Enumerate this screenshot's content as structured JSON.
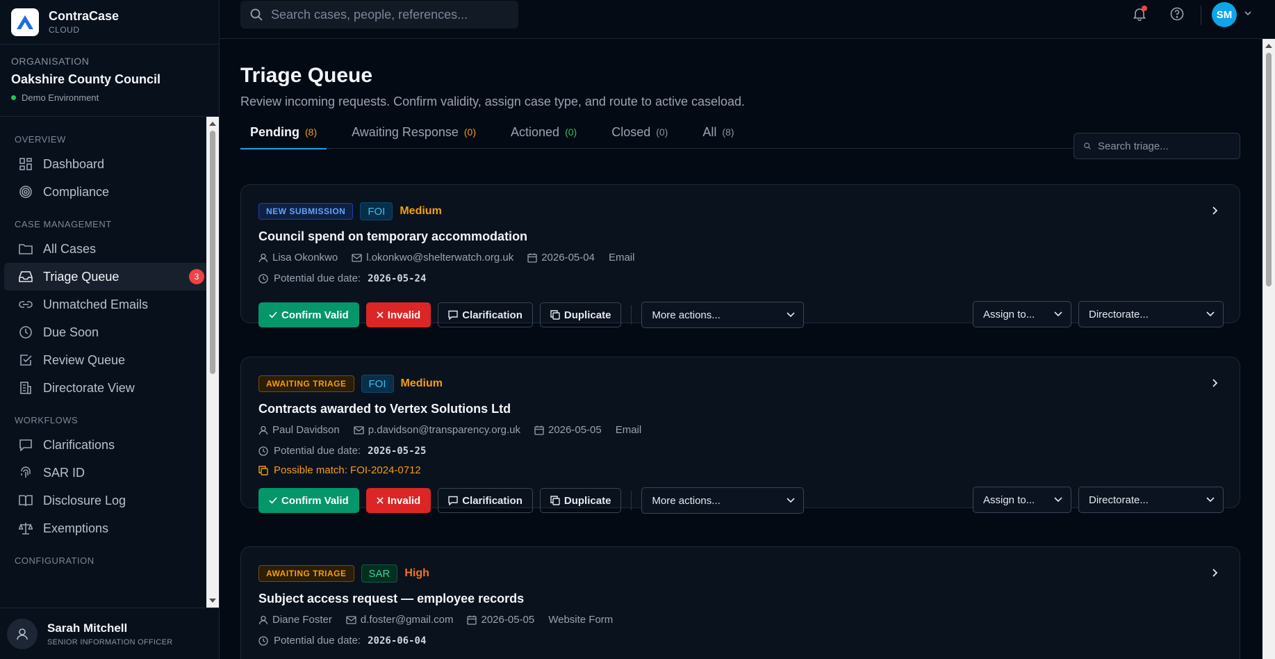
{
  "brand": {
    "name": "ContraCase",
    "sub": "CLOUD"
  },
  "org": {
    "label": "ORGANISATION",
    "name": "Oakshire County Council",
    "env": "Demo Environment"
  },
  "nav": {
    "overview": "OVERVIEW",
    "dashboard": "Dashboard",
    "compliance": "Compliance",
    "case_management": "CASE MANAGEMENT",
    "all_cases": "All Cases",
    "triage_queue": "Triage Queue",
    "triage_badge": "3",
    "unmatched_emails": "Unmatched Emails",
    "due_soon": "Due Soon",
    "review_queue": "Review Queue",
    "directorate_view": "Directorate View",
    "workflows": "WORKFLOWS",
    "clarifications": "Clarifications",
    "sar_id": "SAR ID",
    "disclosure_log": "Disclosure Log",
    "exemptions": "Exemptions",
    "configuration": "CONFIGURATION"
  },
  "user": {
    "name": "Sarah Mitchell",
    "role": "SENIOR INFORMATION OFFICER"
  },
  "topbar": {
    "search_placeholder": "Search cases, people, references...",
    "avatar_initials": "SM"
  },
  "page": {
    "title": "Triage Queue",
    "subtitle": "Review incoming requests. Confirm validity, assign case type, and route to active caseload.",
    "triage_search_placeholder": "Search triage..."
  },
  "tabs": [
    {
      "label": "Pending",
      "count": "(8)"
    },
    {
      "label": "Awaiting Response",
      "count": "(0)"
    },
    {
      "label": "Actioned",
      "count": "(0)"
    },
    {
      "label": "Closed",
      "count": "(0)"
    },
    {
      "label": "All",
      "count": "(8)"
    }
  ],
  "actions": {
    "confirm": "Confirm Valid",
    "invalid": "Invalid",
    "clarification": "Clarification",
    "duplicate": "Duplicate",
    "more": "More actions...",
    "assign": "Assign to...",
    "directorate": "Directorate..."
  },
  "due_label": "Potential due date:",
  "cards": [
    {
      "status": "NEW SUBMISSION",
      "type": "FOI",
      "priority": "Medium",
      "title": "Council spend on temporary accommodation",
      "person": "Lisa Okonkwo",
      "email": "l.okonkwo@shelterwatch.org.uk",
      "date": "2026-05-04",
      "channel": "Email",
      "due": "2026-05-24"
    },
    {
      "status": "AWAITING TRIAGE",
      "type": "FOI",
      "priority": "Medium",
      "title": "Contracts awarded to Vertex Solutions Ltd",
      "person": "Paul Davidson",
      "email": "p.davidson@transparency.org.uk",
      "date": "2026-05-05",
      "channel": "Email",
      "due": "2026-05-25",
      "match": "Possible match: FOI-2024-0712"
    },
    {
      "status": "AWAITING TRIAGE",
      "type": "SAR",
      "priority": "High",
      "title": "Subject access request — employee records",
      "person": "Diane Foster",
      "email": "d.foster@gmail.com",
      "date": "2026-05-05",
      "channel": "Website Form",
      "due": "2026-06-04"
    }
  ],
  "colors": {
    "accent": "#0ea5e9",
    "confirm": "#059669",
    "invalid": "#dc2626",
    "warning": "#f59e0b"
  }
}
